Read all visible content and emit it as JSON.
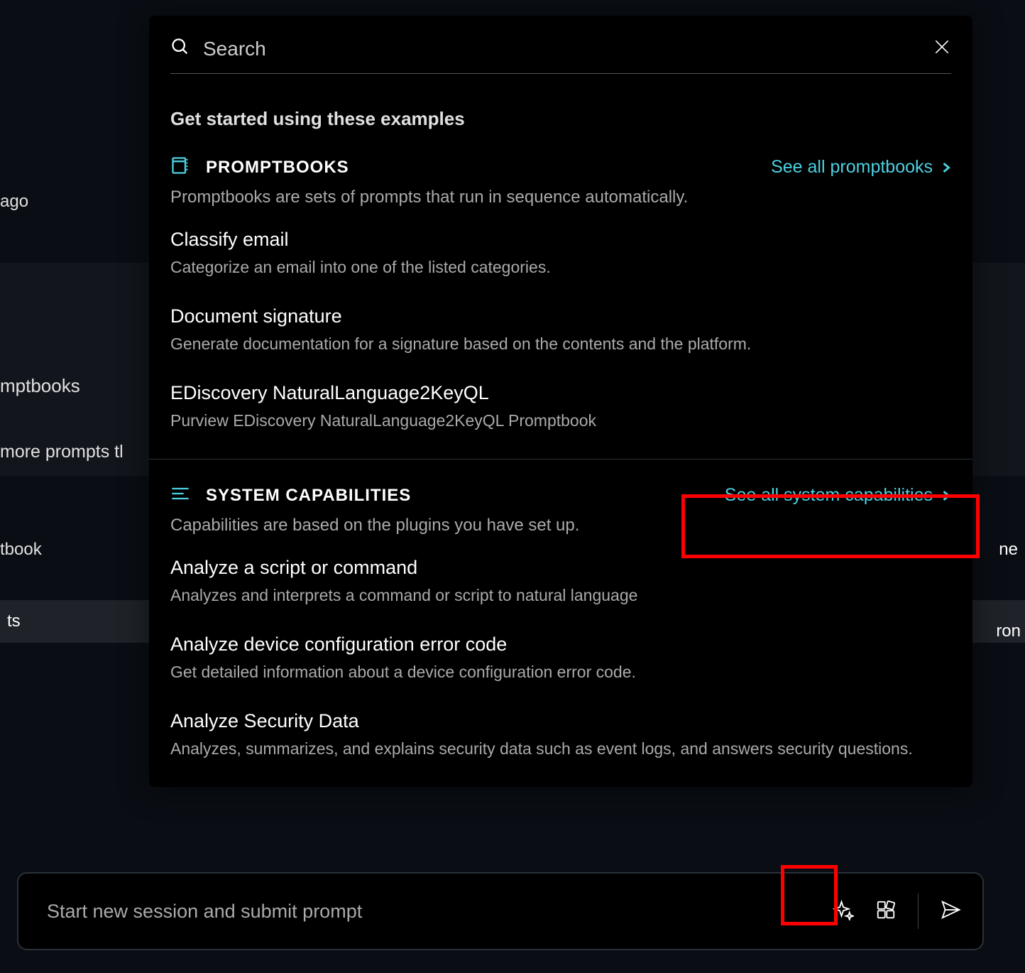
{
  "background": {
    "ago": "ago",
    "mptbooks": "mptbooks",
    "moreprompts": " more prompts tl",
    "tbook": "tbook",
    "ts": "ts",
    "ne": "ne",
    "ron": "ron"
  },
  "modal": {
    "search_placeholder": "Search",
    "intro": "Get started using these examples",
    "promptbooks": {
      "header": "PROMPTBOOKS",
      "see_all": "See all promptbooks",
      "desc": "Promptbooks are sets of prompts that run in sequence automatically.",
      "items": [
        {
          "title": "Classify email",
          "desc": "Categorize an email into one of the listed categories."
        },
        {
          "title": "Document signature",
          "desc": "Generate documentation for a signature based on the contents and the platform."
        },
        {
          "title": "EDiscovery NaturalLanguage2KeyQL",
          "desc": "Purview EDiscovery NaturalLanguage2KeyQL Promptbook"
        }
      ]
    },
    "syscap": {
      "header": "SYSTEM CAPABILITIES",
      "see_all": "See all system capabilities",
      "desc": "Capabilities are based on the plugins you have set up.",
      "items": [
        {
          "title": "Analyze a script or command",
          "desc": "Analyzes and interprets a command or script to natural language"
        },
        {
          "title": "Analyze device configuration error code",
          "desc": "Get detailed information about a device configuration error code."
        },
        {
          "title": "Analyze Security Data",
          "desc": "Analyzes, summarizes, and explains security data such as event logs, and answers security questions."
        }
      ]
    }
  },
  "promptbar": {
    "placeholder": "Start new session and submit prompt"
  }
}
